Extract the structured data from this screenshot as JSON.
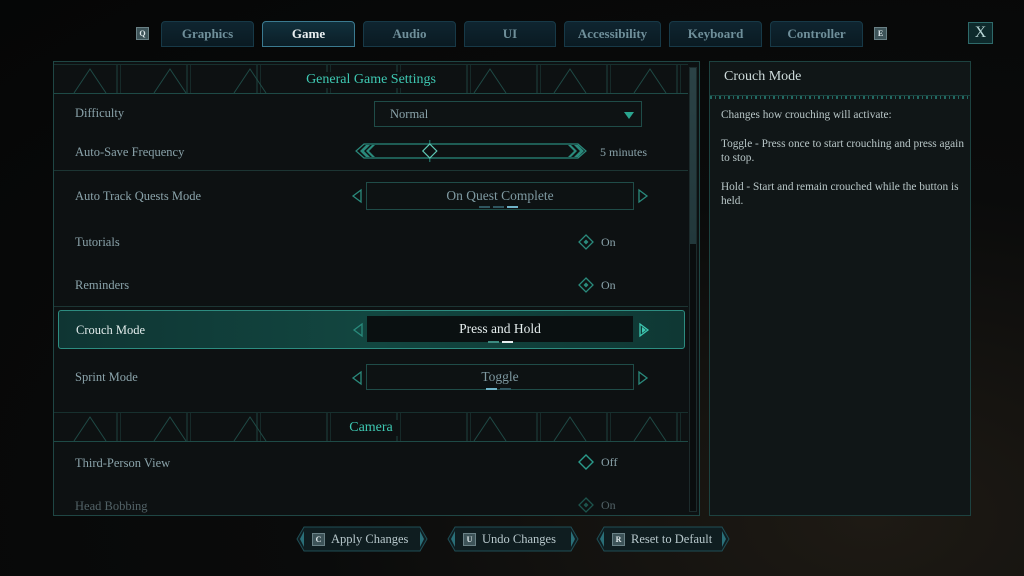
{
  "tabs": {
    "prev_key": "Q",
    "next_key": "E",
    "items": [
      {
        "label": "Graphics",
        "active": false
      },
      {
        "label": "Game",
        "active": true
      },
      {
        "label": "Audio",
        "active": false
      },
      {
        "label": "UI",
        "active": false
      },
      {
        "label": "Accessibility",
        "active": false
      },
      {
        "label": "Keyboard",
        "active": false
      },
      {
        "label": "Controller",
        "active": false
      }
    ],
    "close_label": "X"
  },
  "sections": {
    "general": {
      "title": "General Game Settings",
      "settings": {
        "difficulty": {
          "label": "Difficulty",
          "value": "Normal",
          "icon": "chevron-down-icon"
        },
        "autosave": {
          "label": "Auto-Save Frequency",
          "value": "5 minutes",
          "slider_fraction": 0.2
        },
        "auto_track": {
          "label": "Auto Track Quests Mode",
          "value": "On Quest Complete",
          "option_index": 3,
          "option_count": 3
        },
        "tutorials": {
          "label": "Tutorials",
          "value": "On"
        },
        "reminders": {
          "label": "Reminders",
          "value": "On"
        },
        "crouch": {
          "label": "Crouch Mode",
          "value": "Press and Hold",
          "option_index": 2,
          "option_count": 2,
          "selected": true
        },
        "sprint": {
          "label": "Sprint Mode",
          "value": "Toggle",
          "option_index": 1,
          "option_count": 2
        }
      }
    },
    "camera": {
      "title": "Camera",
      "settings": {
        "third_person": {
          "label": "Third-Person View",
          "value": "Off"
        },
        "head_bobbing": {
          "label": "Head Bobbing",
          "value": "On"
        }
      }
    }
  },
  "scroll_fraction": 0.0,
  "info": {
    "title": "Crouch Mode",
    "paragraphs": [
      "Changes how crouching will activate:",
      "Toggle - Press once to start crouching and press again to stop.",
      "Hold - Start and remain crouched while the button is held."
    ]
  },
  "actions": [
    {
      "key": "C",
      "label": "Apply Changes"
    },
    {
      "key": "U",
      "label": "Undo Changes"
    },
    {
      "key": "R",
      "label": "Reset to Default"
    }
  ],
  "colors": {
    "accent": "#3ec8b2",
    "tab_active_border": "#3b7a90",
    "selected_row": "#124640"
  }
}
